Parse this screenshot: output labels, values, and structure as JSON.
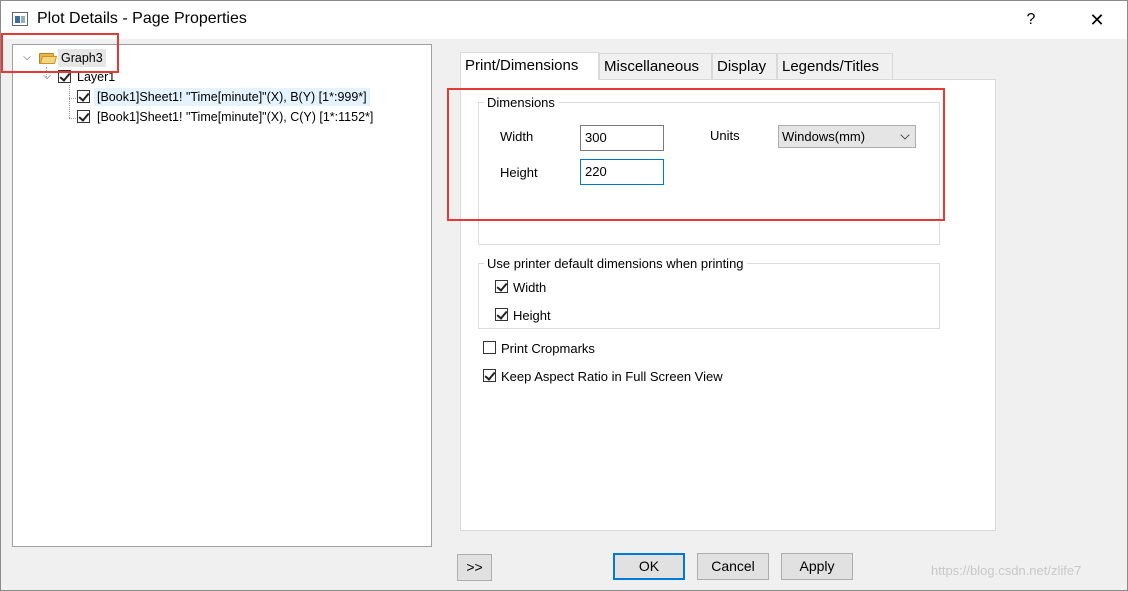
{
  "window": {
    "title": "Plot Details - Page Properties",
    "help_label": "?",
    "close_label": "✕"
  },
  "tree": {
    "root": {
      "label": "Graph3",
      "expanded": true
    },
    "layer": {
      "label": "Layer1",
      "checked": true
    },
    "plots": [
      {
        "label": "[Book1]Sheet1! \"Time[minute]\"(X), B(Y) [1*:999*]",
        "checked": true,
        "selected": true
      },
      {
        "label": "[Book1]Sheet1! \"Time[minute]\"(X), C(Y) [1*:1152*]",
        "checked": true,
        "selected": false
      }
    ]
  },
  "tabs": [
    {
      "label": "Print/Dimensions",
      "active": true
    },
    {
      "label": "Miscellaneous",
      "active": false
    },
    {
      "label": "Display",
      "active": false
    },
    {
      "label": "Legends/Titles",
      "active": false
    }
  ],
  "dimensions": {
    "group_label": "Dimensions",
    "width_label": "Width",
    "width_value": "300",
    "height_label": "Height",
    "height_value": "220",
    "units_label": "Units",
    "units_value": "Windows(mm)"
  },
  "printer_defaults": {
    "group_label": "Use printer default dimensions when printing",
    "width_label": "Width",
    "width_checked": true,
    "height_label": "Height",
    "height_checked": true
  },
  "options": {
    "print_cropmarks_label": "Print Cropmarks",
    "print_cropmarks_checked": false,
    "keep_aspect_label": "Keep Aspect Ratio in Full Screen View",
    "keep_aspect_checked": true
  },
  "buttons": {
    "expand_label": ">>",
    "ok_label": "OK",
    "cancel_label": "Cancel",
    "apply_label": "Apply"
  },
  "watermark": "https://blog.csdn.net/zlife7",
  "colors": {
    "highlight_box": "#e53935",
    "focus_border": "#0078d7",
    "selection_bg": "#e5f3ff"
  }
}
